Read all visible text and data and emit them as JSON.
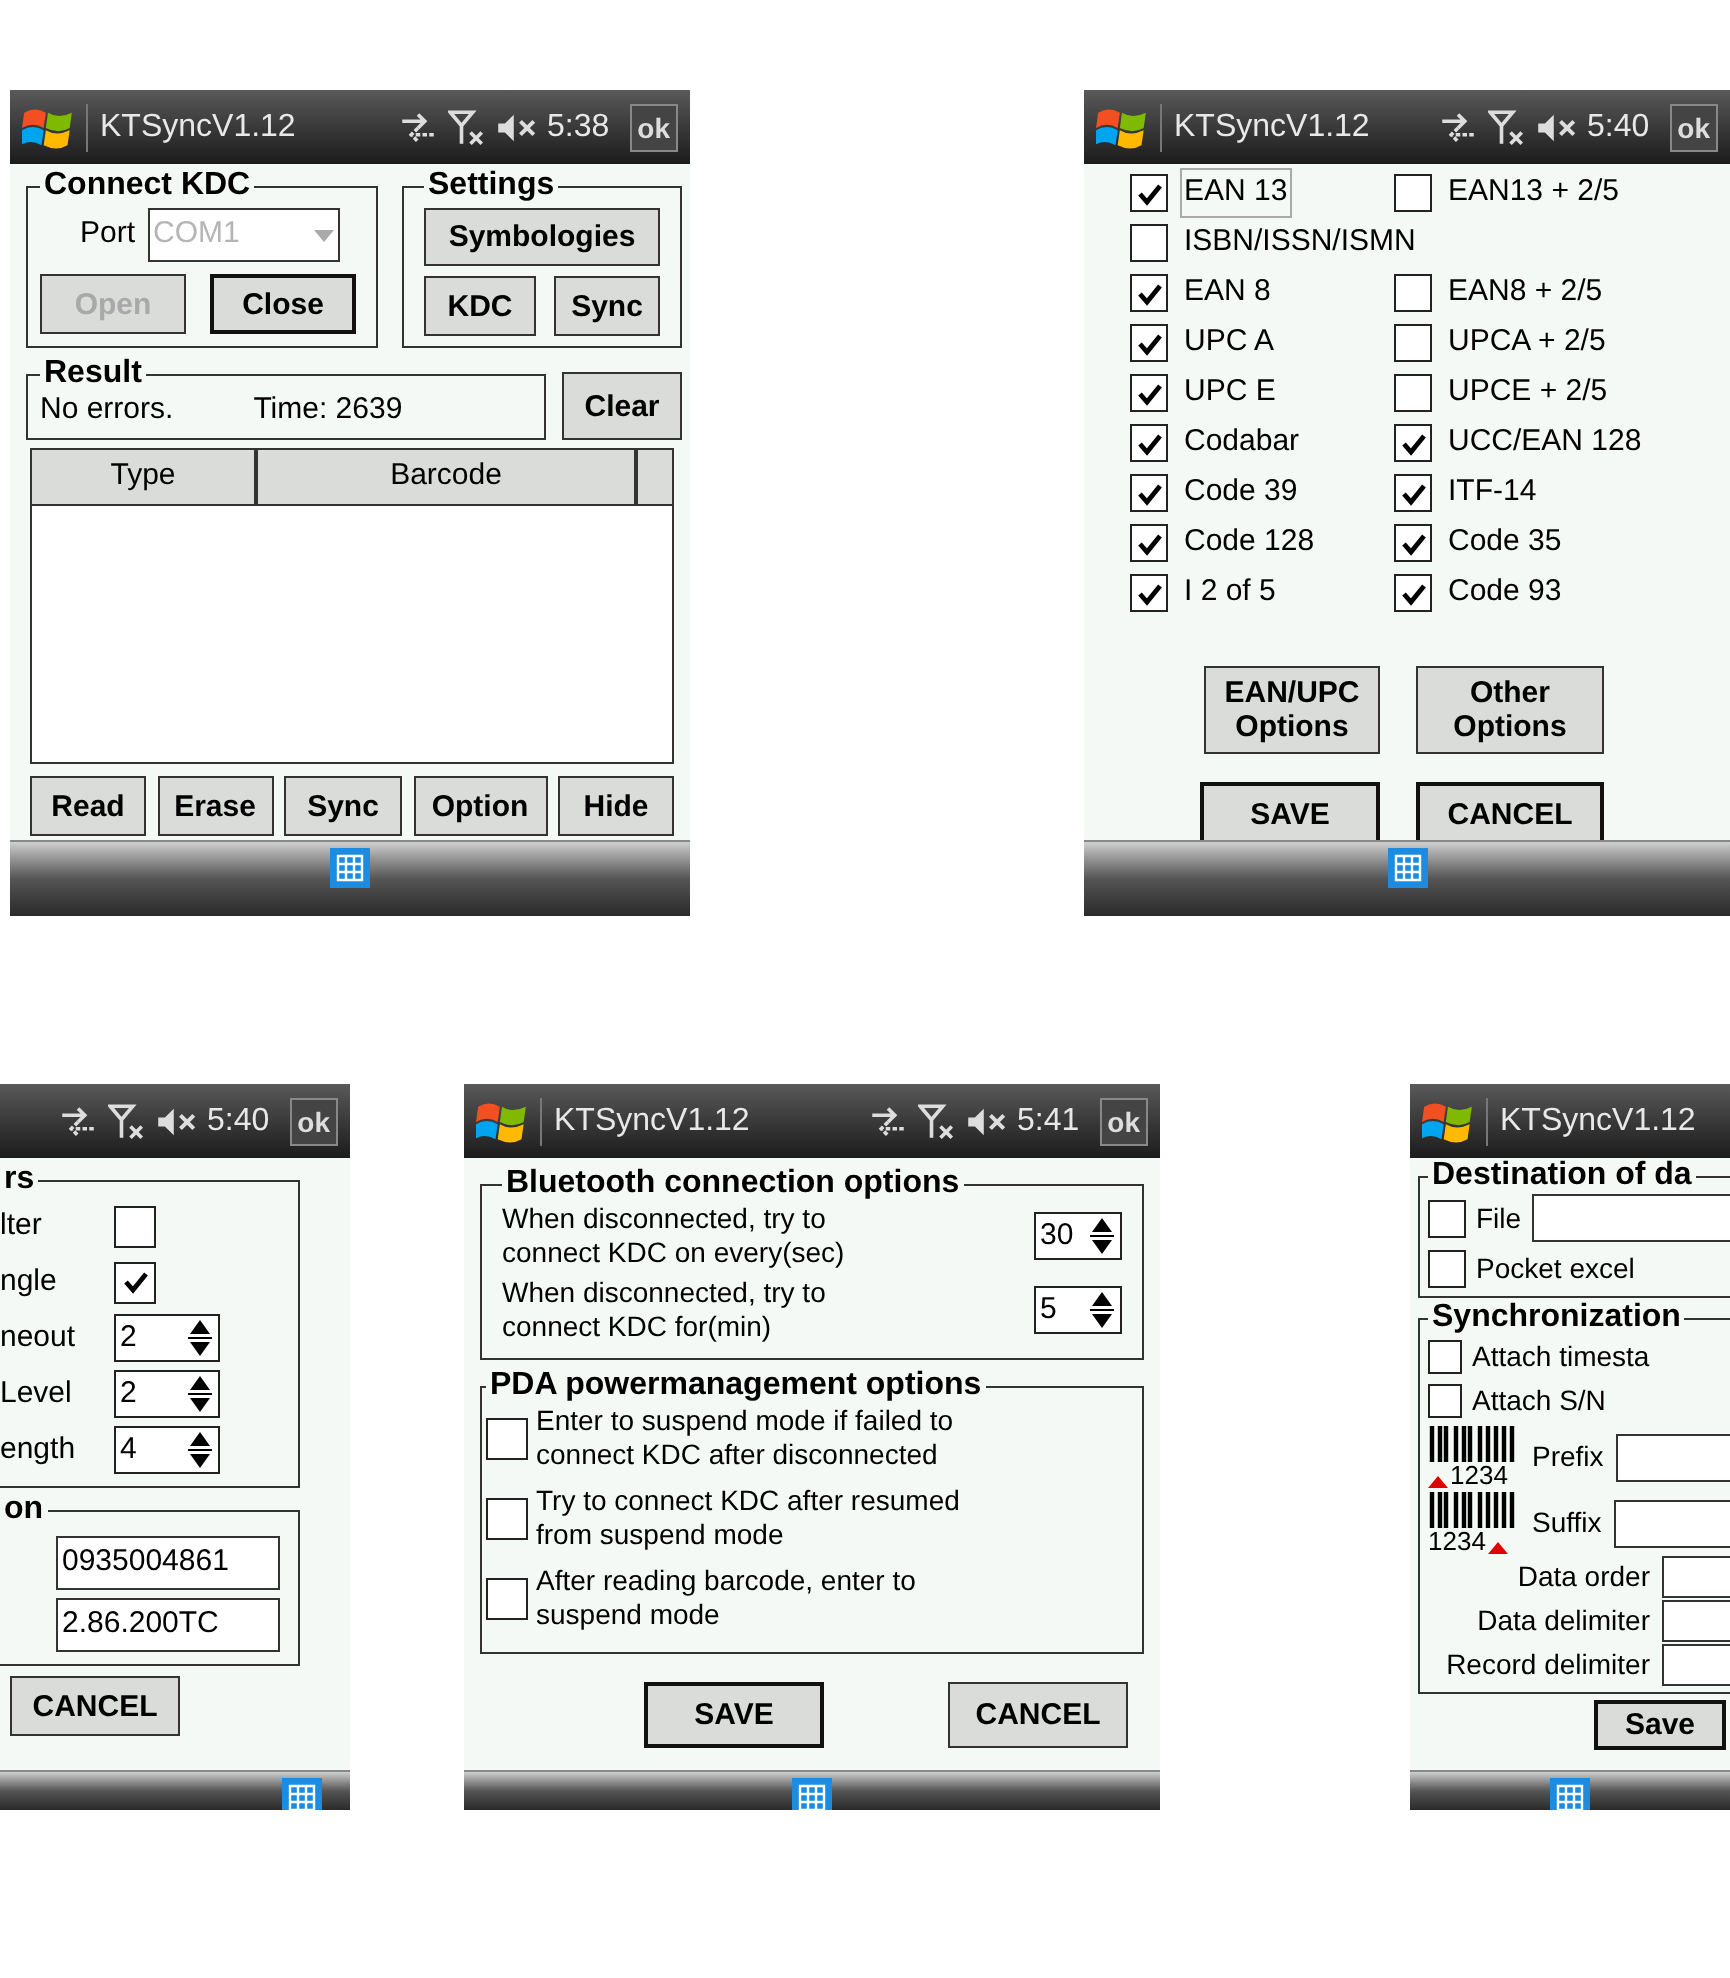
{
  "main_screen": {
    "status": {
      "title": "KTSyncV1.12",
      "time": "5:38",
      "ok": "ok"
    },
    "connect_kdc": {
      "title": "Connect KDC",
      "port_label": "Port",
      "port_value": "COM1",
      "port_disabled": true,
      "buttons": [
        {
          "label": "Open",
          "disabled": true,
          "default": false
        },
        {
          "label": "Close",
          "disabled": false,
          "default": true
        }
      ]
    },
    "settings": {
      "title": "Settings",
      "buttons": [
        "Symbologies",
        "KDC",
        "Sync"
      ]
    },
    "result": {
      "title": "Result",
      "message": "No errors.",
      "time": "Time: 2639"
    },
    "clear_button": "Clear",
    "table": {
      "columns": [
        "Type",
        "Barcode"
      ]
    },
    "buttons": [
      "Read",
      "Erase",
      "Sync",
      "Option",
      "Hide"
    ]
  },
  "symbologies_screen": {
    "status": {
      "title": "KTSyncV1.12",
      "time": "5:40",
      "ok": "ok"
    },
    "items": [
      {
        "kind": "cell",
        "label": "EAN 13",
        "checked": true,
        "focused": true
      },
      {
        "kind": "cell",
        "label": "EAN13 + 2/5",
        "checked": false,
        "focused": false
      },
      {
        "kind": "wide",
        "label": "ISBN/ISSN/ISMN",
        "checked": false,
        "focused": false
      },
      {
        "kind": "cell",
        "label": "EAN 8",
        "checked": true,
        "focused": false
      },
      {
        "kind": "cell",
        "label": "EAN8 + 2/5",
        "checked": false,
        "focused": false
      },
      {
        "kind": "cell",
        "label": "UPC A",
        "checked": true,
        "focused": false
      },
      {
        "kind": "cell",
        "label": "UPCA + 2/5",
        "checked": false,
        "focused": false
      },
      {
        "kind": "cell",
        "label": "UPC E",
        "checked": true,
        "focused": false
      },
      {
        "kind": "cell",
        "label": "UPCE + 2/5",
        "checked": false,
        "focused": false
      },
      {
        "kind": "cell",
        "label": "Codabar",
        "checked": true,
        "focused": false
      },
      {
        "kind": "cell",
        "label": "UCC/EAN 128",
        "checked": true,
        "focused": false
      },
      {
        "kind": "cell",
        "label": "Code 39",
        "checked": true,
        "focused": false
      },
      {
        "kind": "cell",
        "label": "ITF-14",
        "checked": true,
        "focused": false
      },
      {
        "kind": "cell",
        "label": "Code 128",
        "checked": true,
        "focused": false
      },
      {
        "kind": "cell",
        "label": "Code 35",
        "checked": true,
        "focused": false
      },
      {
        "kind": "cell",
        "label": "I 2 of 5",
        "checked": true,
        "focused": false
      },
      {
        "kind": "cell",
        "label": "Code 93",
        "checked": true,
        "focused": false
      }
    ],
    "option_buttons": [
      "EAN/UPC\nOptions",
      "Other\nOptions"
    ],
    "buttons": [
      {
        "label": "SAVE",
        "default": true
      },
      {
        "label": "CANCEL",
        "default": true
      }
    ]
  },
  "kdc_screen": {
    "status": {
      "time": "5:40",
      "ok": "ok"
    },
    "parameters": {
      "title": "rs",
      "rows": [
        {
          "kind": "checkbox",
          "label": "lter",
          "checked": false
        },
        {
          "kind": "checkbox",
          "label": "ngle",
          "checked": true
        },
        {
          "kind": "spinner",
          "label": "neout",
          "value": "2"
        },
        {
          "kind": "spinner",
          "label": "Level",
          "value": "2"
        },
        {
          "kind": "spinner",
          "label": "ength",
          "value": "4"
        }
      ]
    },
    "information": {
      "title": "on",
      "fields": [
        "0935004861",
        "2.86.200TC"
      ]
    },
    "cancel_button": "CANCEL"
  },
  "bluetooth_screen": {
    "status": {
      "title": "KTSyncV1.12",
      "time": "5:41",
      "ok": "ok"
    },
    "bluetooth": {
      "title": "Bluetooth connection options",
      "rows": [
        {
          "label": "When disconnected, try to\nconnect KDC on every(sec)",
          "value": "30"
        },
        {
          "label": "When disconnected, try to\nconnect KDC for(min)",
          "value": "5"
        }
      ]
    },
    "power": {
      "title": "PDA powermanagement options",
      "items": [
        {
          "label": "Enter to suspend mode if failed to\nconnect KDC after disconnected",
          "checked": false
        },
        {
          "label": "Try to connect KDC after resumed\nfrom suspend mode",
          "checked": false
        },
        {
          "label": "After reading barcode, enter to\nsuspend mode",
          "checked": false
        }
      ]
    },
    "buttons": [
      {
        "label": "SAVE",
        "default": true
      },
      {
        "label": "CANCEL",
        "default": false
      }
    ]
  },
  "sync_screen": {
    "status": {
      "title": "KTSyncV1.12"
    },
    "destination": {
      "title": "Destination of da",
      "file": {
        "label": "File",
        "checked": false
      },
      "excel": {
        "label": "Pocket excel",
        "checked": false
      }
    },
    "synchronization": {
      "title": "Synchronization",
      "options": [
        {
          "label": "Attach timesta",
          "checked": false
        },
        {
          "label": "Attach S/N",
          "checked": false
        }
      ],
      "prefix": {
        "label": "Prefix",
        "code": "1234"
      },
      "suffix": {
        "label": "Suffix",
        "code": "1234"
      },
      "fields": [
        "Data order",
        "Data delimiter",
        "Record delimiter"
      ]
    },
    "save_button": "Save"
  }
}
